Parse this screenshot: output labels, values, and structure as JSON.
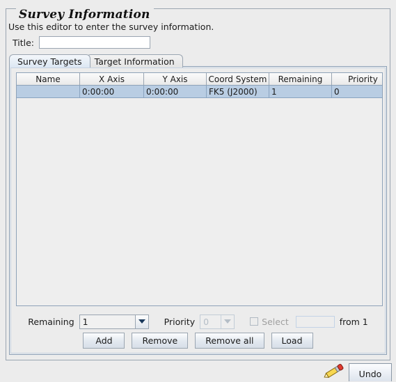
{
  "panel": {
    "title": "Survey Information",
    "instructions": "Use this editor to enter the survey information."
  },
  "title_field": {
    "label": "Title:",
    "value": "",
    "placeholder": ""
  },
  "tabs": [
    {
      "label": "Survey Targets",
      "selected": true
    },
    {
      "label": "Target Information",
      "selected": false
    }
  ],
  "table": {
    "columns": [
      "Name",
      "X Axis",
      "Y Axis",
      "Coord System",
      "Remaining",
      "Priority"
    ],
    "rows": [
      {
        "name": "",
        "x_axis": "0:00:00",
        "y_axis": "0:00:00",
        "coord_system": "FK5 (J2000)",
        "remaining": "1",
        "priority": "0",
        "selected": true
      }
    ]
  },
  "controls": {
    "remaining_label": "Remaining",
    "remaining_value": "1",
    "priority_label": "Priority",
    "priority_value": "0",
    "select_label": "Select",
    "select_count_value": "",
    "from_label": "from 1"
  },
  "buttons": {
    "add": "Add",
    "remove": "Remove",
    "remove_all": "Remove all",
    "load": "Load"
  },
  "bottom_bar": {
    "undo": "Undo",
    "edit_icon": "pencil-icon"
  },
  "colors": {
    "window_background": "#ececec",
    "selection_blue": "#b9cde3",
    "border_gray": "#9aa5b1",
    "tab_selected": "#dce7f3",
    "disabled_text": "#a0a0a0"
  }
}
